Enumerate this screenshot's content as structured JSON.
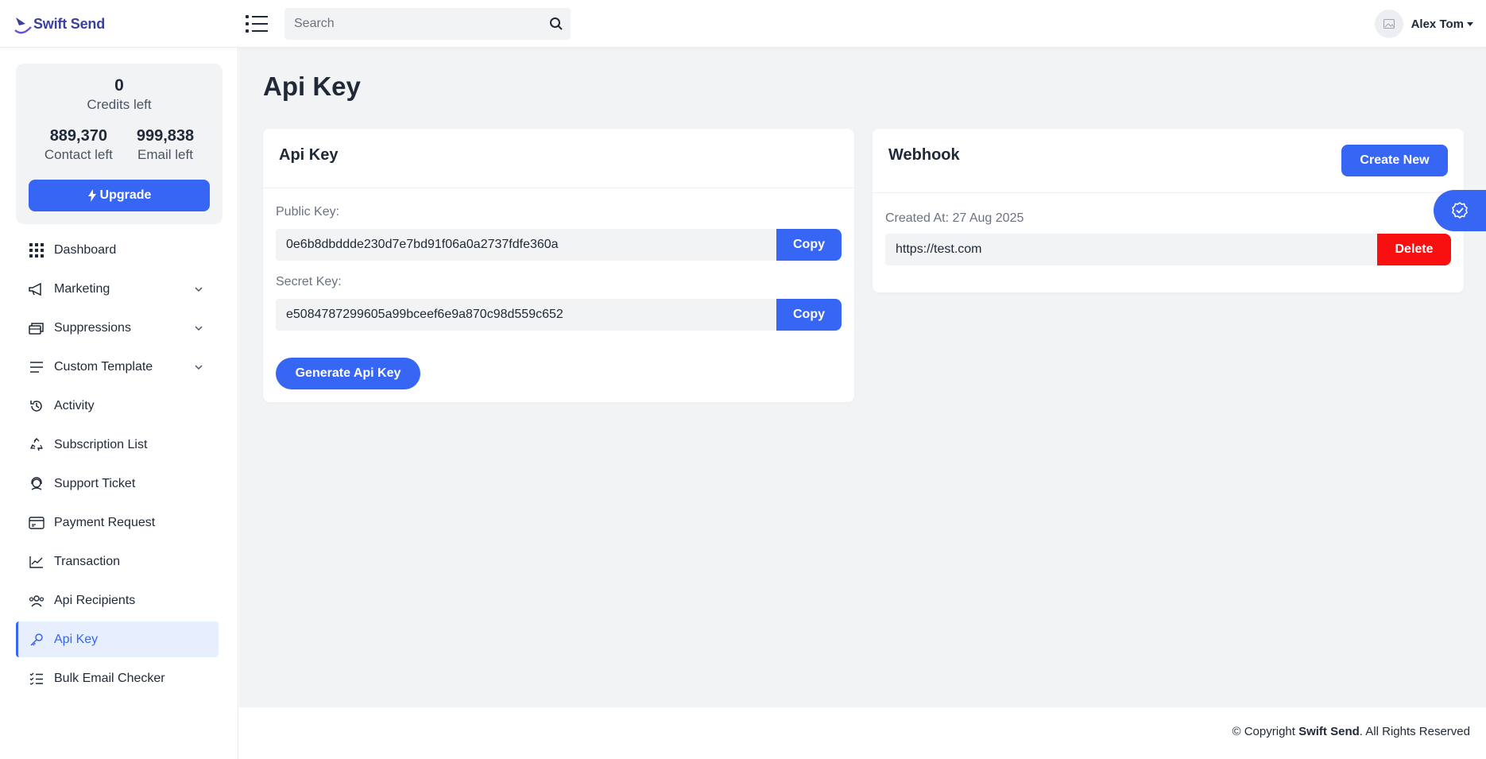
{
  "app": {
    "brand": "Swift Send"
  },
  "header": {
    "search_placeholder": "Search",
    "user_name": "Alex Tom"
  },
  "sidebar": {
    "credits": {
      "credits_value": "0",
      "credits_label": "Credits left",
      "contact_value": "889,370",
      "contact_label": "Contact left",
      "email_value": "999,838",
      "email_label": "Email left",
      "upgrade_label": "Upgrade"
    },
    "items": [
      {
        "label": "Dashboard",
        "icon": "grid-icon"
      },
      {
        "label": "Marketing",
        "icon": "megaphone-icon"
      },
      {
        "label": "Suppressions",
        "icon": "stack-icon"
      },
      {
        "label": "Custom Template",
        "icon": "lines-icon"
      },
      {
        "label": "Activity",
        "icon": "history-icon"
      },
      {
        "label": "Subscription List",
        "icon": "recycle-icon"
      },
      {
        "label": "Support Ticket",
        "icon": "headset-icon"
      },
      {
        "label": "Payment Request",
        "icon": "card-icon"
      },
      {
        "label": "Transaction",
        "icon": "chart-line-icon"
      },
      {
        "label": "Api Recipients",
        "icon": "users-icon"
      },
      {
        "label": "Api Key",
        "icon": "key-icon"
      },
      {
        "label": "Bulk Email Checker",
        "icon": "checklist-icon"
      }
    ]
  },
  "main": {
    "page_title": "Api Key",
    "api_card": {
      "title": "Api Key",
      "public_label": "Public Key:",
      "public_value": "0e6b8dbddde230d7e7bd91f06a0a2737fdfe360a",
      "secret_label": "Secret Key:",
      "secret_value": "e5084787299605a99bceef6e9a870c98d559c652",
      "copy_label": "Copy",
      "generate_label": "Generate Api Key"
    },
    "webhook_card": {
      "title": "Webhook",
      "create_label": "Create New",
      "created_at": "Created At: 27 Aug 2025",
      "url": "https://test.com",
      "delete_label": "Delete"
    }
  },
  "footer": {
    "prefix": "© Copyright",
    "brand": "Swift Send",
    "suffix": ". All Rights Reserved"
  },
  "colors": {
    "primary": "#3766f4",
    "danger": "#f80f0f",
    "active_bg": "#e7eefe",
    "surface": "#f1f3f5"
  }
}
